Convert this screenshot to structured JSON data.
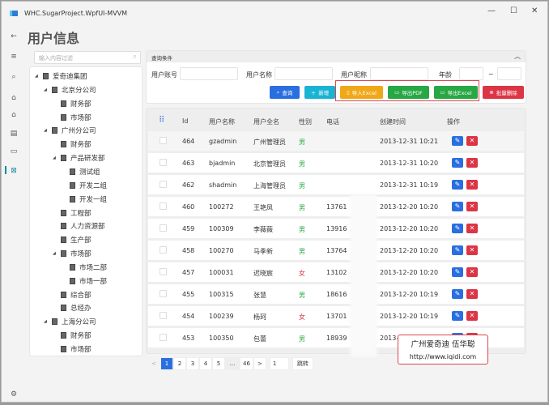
{
  "window": {
    "title": "WHC.SugarProject.WpfUI-MVVM",
    "minimize": "—",
    "maximize": "☐",
    "close": "✕"
  },
  "rail": {
    "icons": [
      "back-arrow-icon",
      "menu-icon",
      "search-icon",
      "home-icon",
      "home-outline-icon",
      "document-icon",
      "card-icon",
      "chart-icon",
      "settings-icon"
    ],
    "glyphs": [
      "←",
      "≡",
      "⌕",
      "⌂",
      "⌂",
      "▤",
      "▭",
      "⊠",
      "⚙"
    ]
  },
  "page": {
    "title": "用户信息"
  },
  "tree_filter": {
    "placeholder": "输入内容过滤"
  },
  "tree": [
    {
      "label": "爱奇迪集团",
      "level": 0,
      "expanded": true
    },
    {
      "label": "北京分公司",
      "level": 1,
      "expanded": true
    },
    {
      "label": "财务部",
      "level": 2
    },
    {
      "label": "市场部",
      "level": 2
    },
    {
      "label": "广州分公司",
      "level": 1,
      "expanded": true
    },
    {
      "label": "财务部",
      "level": 2
    },
    {
      "label": "产品研发部",
      "level": 2,
      "expanded": true
    },
    {
      "label": "测试组",
      "level": 3
    },
    {
      "label": "开发二组",
      "level": 3
    },
    {
      "label": "开发一组",
      "level": 3
    },
    {
      "label": "工程部",
      "level": 2
    },
    {
      "label": "人力资源部",
      "level": 2
    },
    {
      "label": "生产部",
      "level": 2
    },
    {
      "label": "市场部",
      "level": 2,
      "expanded": true
    },
    {
      "label": "市场二部",
      "level": 3
    },
    {
      "label": "市场一部",
      "level": 3
    },
    {
      "label": "综合部",
      "level": 2
    },
    {
      "label": "总经办",
      "level": 2
    },
    {
      "label": "上海分公司",
      "level": 1,
      "expanded": true
    },
    {
      "label": "财务部",
      "level": 2
    },
    {
      "label": "市场部",
      "level": 2
    }
  ],
  "query": {
    "title": "查询条件",
    "collapse": "︿",
    "fields": {
      "account": "用户账号",
      "name": "用户名称",
      "nickname": "用户昵称",
      "age": "年龄",
      "tilde": "~"
    },
    "buttons": {
      "search": "查询",
      "add": "新增",
      "import_excel": "导入Excel",
      "export_pdf": "导出PDF",
      "export_excel": "导出Excel",
      "batch_delete": "批量删除"
    },
    "colors": {
      "search": "#2a6fe0",
      "add": "#19b3d3",
      "import_excel": "#f0a818",
      "export_pdf": "#28a745",
      "export_excel": "#28a745",
      "batch_delete": "#dc3545",
      "highlight": "#d9484e"
    }
  },
  "table": {
    "columns": [
      "Id",
      "用户名称",
      "用户全名",
      "性别",
      "电话",
      "创建时间",
      "操作"
    ],
    "rows": [
      {
        "id": "464",
        "username": "gzadmin",
        "fullname": "广州管理员",
        "gender": "男",
        "phone": "",
        "created": "2013-12-31 10:21"
      },
      {
        "id": "463",
        "username": "bjadmin",
        "fullname": "北京管理员",
        "gender": "男",
        "phone": "",
        "created": "2013-12-31 10:20"
      },
      {
        "id": "462",
        "username": "shadmin",
        "fullname": "上海管理员",
        "gender": "男",
        "phone": "",
        "created": "2013-12-31 10:19"
      },
      {
        "id": "460",
        "username": "100272",
        "fullname": "王艳凤",
        "gender": "男",
        "phone": "13761",
        "created": "2013-12-20 10:20"
      },
      {
        "id": "459",
        "username": "100309",
        "fullname": "李薇薇",
        "gender": "男",
        "phone": "13916",
        "created": "2013-12-20 10:20"
      },
      {
        "id": "458",
        "username": "100270",
        "fullname": "马季新",
        "gender": "男",
        "phone": "13764",
        "created": "2013-12-20 10:20"
      },
      {
        "id": "457",
        "username": "100031",
        "fullname": "迟晓宸",
        "gender": "女",
        "phone": "13102",
        "created": "2013-12-20 10:20"
      },
      {
        "id": "455",
        "username": "100315",
        "fullname": "张慧",
        "gender": "男",
        "phone": "18616",
        "created": "2013-12-20 10:19"
      },
      {
        "id": "454",
        "username": "100239",
        "fullname": "杨珂",
        "gender": "女",
        "phone": "13701",
        "created": "2013-12-20 10:19"
      },
      {
        "id": "453",
        "username": "100350",
        "fullname": "包蕾",
        "gender": "男",
        "phone": "18939",
        "created": "2013-"
      }
    ],
    "edit_glyph": "✎",
    "delete_glyph": "✕"
  },
  "pagination": {
    "prev": "<",
    "pages": [
      "1",
      "2",
      "3",
      "4",
      "5",
      "...",
      "46"
    ],
    "current": "1",
    "next": ">",
    "jump_value": "1",
    "jump_label": "跳转"
  },
  "watermark": {
    "line1": "广州爱奇迪 伍华聪",
    "line2": "http://www.iqidi.com"
  }
}
